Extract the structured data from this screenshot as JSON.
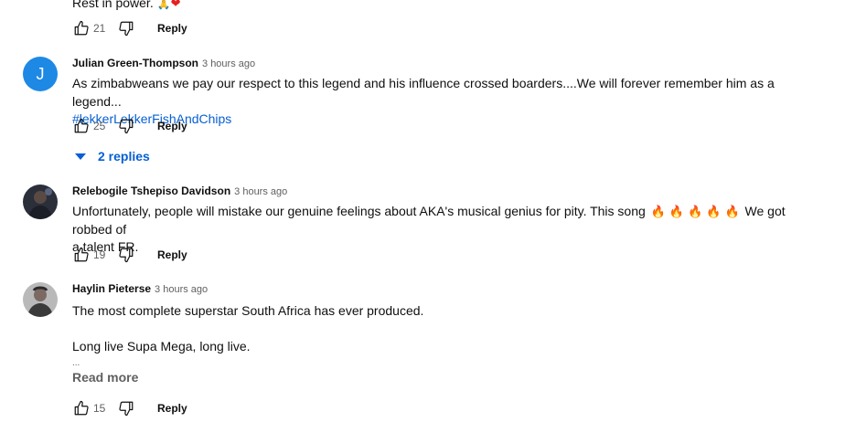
{
  "comments": [
    {
      "text_prefix": "Rest in power.",
      "likes": "21",
      "reply_label": "Reply"
    },
    {
      "avatar_letter": "J",
      "author": "Julian Green-Thompson",
      "time": "3 hours ago",
      "text": "As zimbabweans we pay our respect to this legend and his influence crossed boarders....We will forever remember him as a legend...",
      "hashtag": "#lekkerLekkerFishAndChips",
      "likes": "25",
      "reply_label": "Reply",
      "replies_label": "2 replies"
    },
    {
      "author": "Relebogile Tshepiso Davidson",
      "time": "3 hours ago",
      "text_a": "Unfortunately, people will mistake our genuine feelings about AKA's musical genius for pity. This song",
      "text_b": "We got robbed of",
      "text_c": "a talent FR.",
      "likes": "19",
      "reply_label": "Reply"
    },
    {
      "author": "Haylin Pieterse",
      "time": "3 hours ago",
      "line1": "The most complete superstar South Africa has ever produced.",
      "line2": "Long live Supa Mega, long live.",
      "ellipsis": "...",
      "read_more": "Read more",
      "likes": "15",
      "reply_label": "Reply"
    }
  ],
  "colors": {
    "link": "#065fd4",
    "meta": "#606060",
    "avatar_j": "#1e88e5"
  },
  "icons": [
    "thumbs-up-icon",
    "thumbs-down-icon",
    "caret-down-icon",
    "fire-emoji",
    "pray-emoji",
    "heart-emoji"
  ]
}
